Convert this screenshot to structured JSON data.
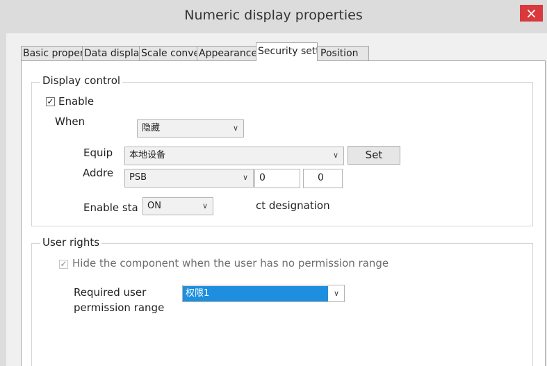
{
  "window": {
    "title": "Numeric display properties",
    "close_glyph": "×"
  },
  "tabs": [
    {
      "label": "Basic properties",
      "active": false
    },
    {
      "label": "Data display",
      "active": false
    },
    {
      "label": "Scale conversion",
      "active": false
    },
    {
      "label": "Appearance",
      "active": false
    },
    {
      "label": "Security settings",
      "active": true
    },
    {
      "label": "Position",
      "active": false
    }
  ],
  "display_control": {
    "legend": "Display control",
    "enable_label": "Enable",
    "enable_checked": true,
    "when_label": "When",
    "when_value": "隐藏",
    "equip_label": "Equip",
    "equip_value": "本地设备",
    "set_button": "Set",
    "addr_label": "Addre",
    "addr_type": "PSB",
    "addr_value1": "0",
    "addr_value2": "0",
    "enable_state_label": "Enable sta",
    "enable_state_value": "ON",
    "designation_text": "ct designation"
  },
  "user_rights": {
    "legend": "User rights",
    "hide_label": "Hide the component when the user has no permission range",
    "hide_checked": true,
    "required_label_line1": "Required user",
    "required_label_line2": "permission range",
    "permission_value": "权限1"
  },
  "colors": {
    "close_button": "#d9383c",
    "selection": "#1e8fde"
  },
  "icons": {
    "close": "close-icon",
    "dropdown": "chevron-down-icon",
    "check": "checkmark-icon"
  }
}
